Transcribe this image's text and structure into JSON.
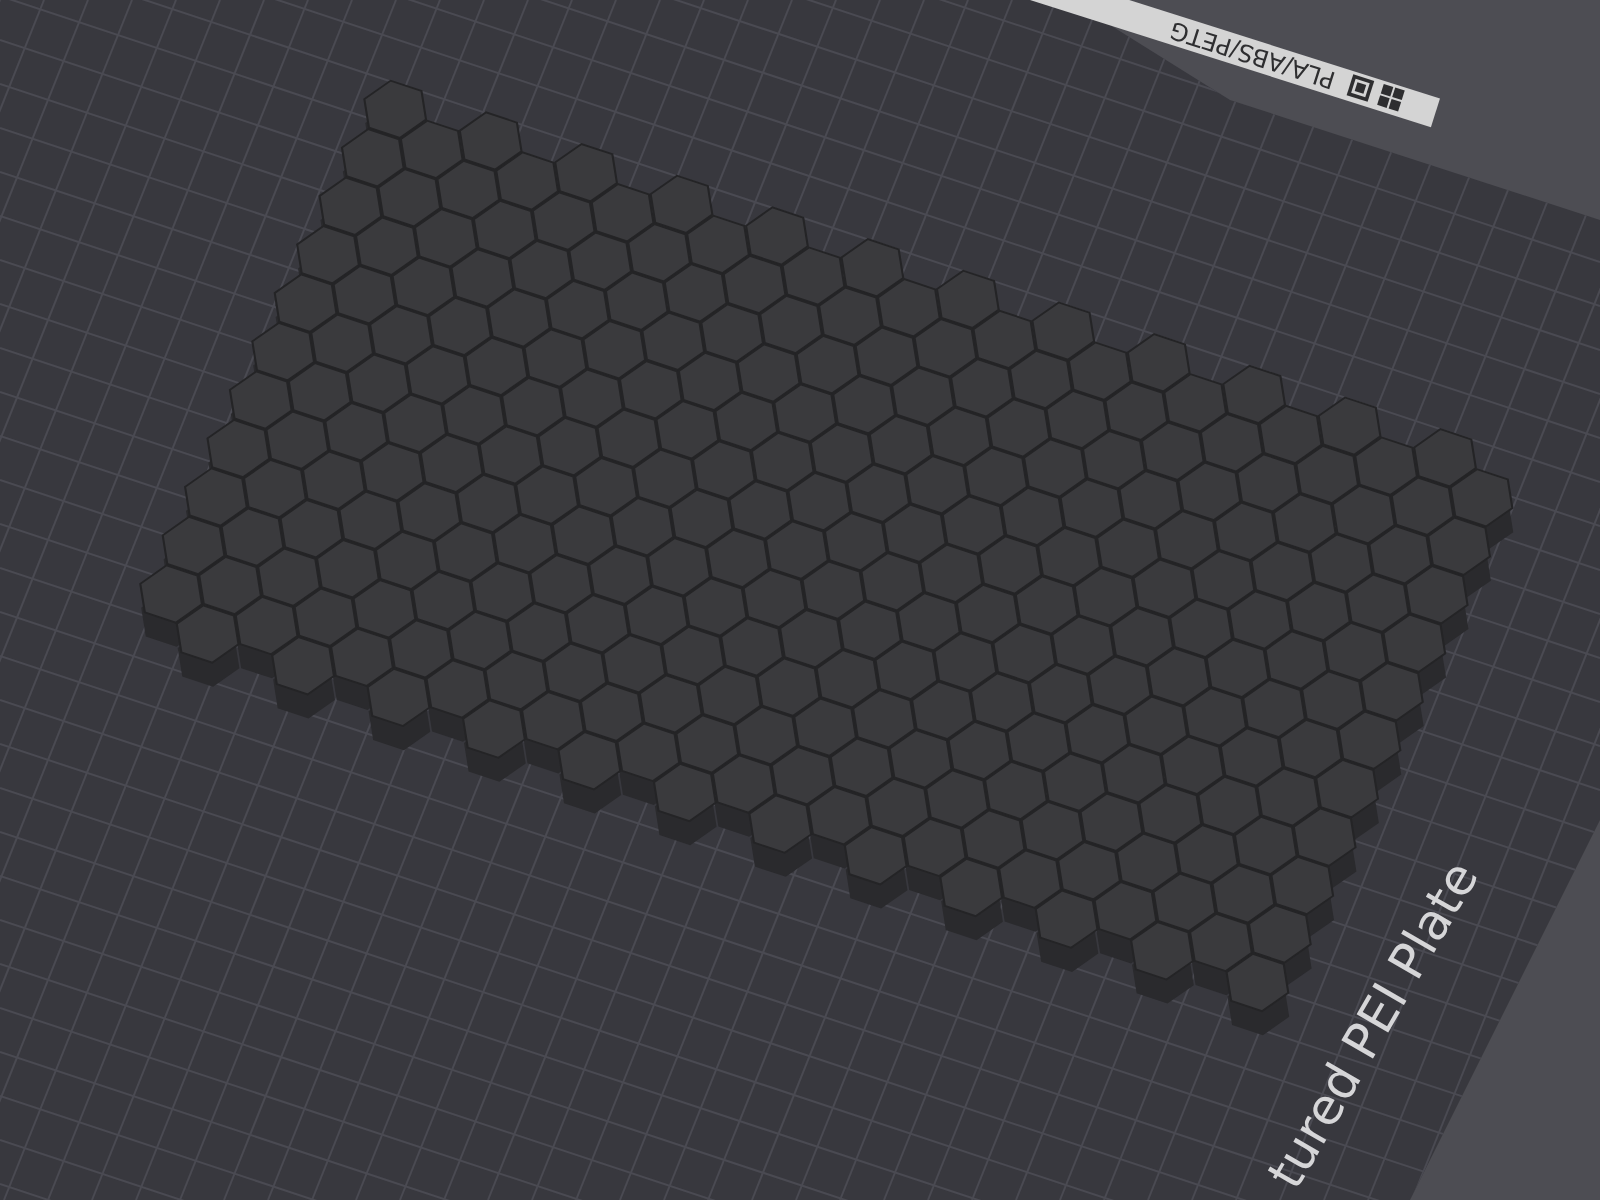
{
  "viewport": {
    "filament_label": "PLA/ABS/PETG",
    "plate_label": "tured PEI Plate"
  }
}
